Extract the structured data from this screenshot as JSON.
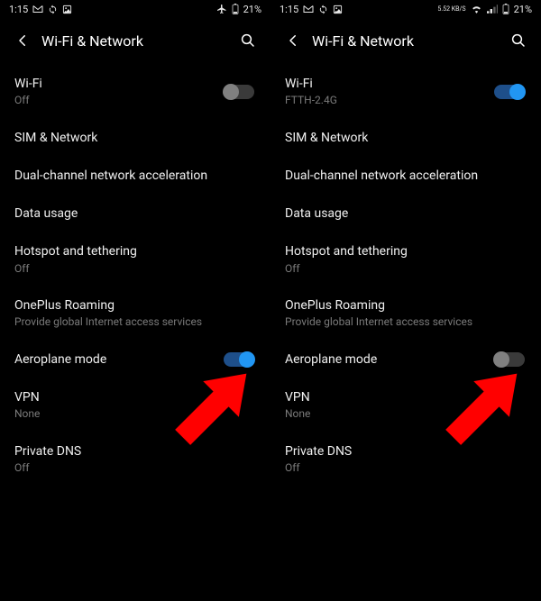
{
  "screens": [
    {
      "statusbar": {
        "time": "1:15",
        "icons_left": [
          "gmail-icon",
          "sync-icon",
          "image-icon"
        ],
        "icons_right": [
          "airplane-icon"
        ],
        "battery_text": "21%",
        "has_wifi": false,
        "has_signal": false,
        "speed": ""
      },
      "header": {
        "title": "Wi-Fi & Network"
      },
      "items": [
        {
          "label": "Wi-Fi",
          "sub": "Off",
          "toggle": "off"
        },
        {
          "label": "SIM & Network",
          "sub": ""
        },
        {
          "label": "Dual-channel network acceleration",
          "sub": ""
        },
        {
          "label": "Data usage",
          "sub": ""
        },
        {
          "label": "Hotspot and tethering",
          "sub": "Off"
        },
        {
          "label": "OnePlus Roaming",
          "sub": "Provide global Internet access services"
        },
        {
          "label": "Aeroplane mode",
          "sub": "",
          "toggle": "on"
        },
        {
          "label": "VPN",
          "sub": "None"
        },
        {
          "label": "Private DNS",
          "sub": "Off"
        }
      ]
    },
    {
      "statusbar": {
        "time": "1:15",
        "icons_left": [
          "gmail-icon",
          "sync-icon",
          "image-icon"
        ],
        "icons_right": [],
        "battery_text": "21%",
        "has_wifi": true,
        "has_signal": true,
        "speed": "5.52 KB/S"
      },
      "header": {
        "title": "Wi-Fi & Network"
      },
      "items": [
        {
          "label": "Wi-Fi",
          "sub": "FTTH-2.4G",
          "toggle": "on"
        },
        {
          "label": "SIM & Network",
          "sub": ""
        },
        {
          "label": "Dual-channel network acceleration",
          "sub": ""
        },
        {
          "label": "Data usage",
          "sub": ""
        },
        {
          "label": "Hotspot and tethering",
          "sub": "Off"
        },
        {
          "label": "OnePlus Roaming",
          "sub": "Provide global Internet access services"
        },
        {
          "label": "Aeroplane mode",
          "sub": "",
          "toggle": "off"
        },
        {
          "label": "VPN",
          "sub": "None"
        },
        {
          "label": "Private DNS",
          "sub": "Off"
        }
      ]
    }
  ],
  "colors": {
    "accent": "#2196f3",
    "arrow": "#ff0000"
  }
}
